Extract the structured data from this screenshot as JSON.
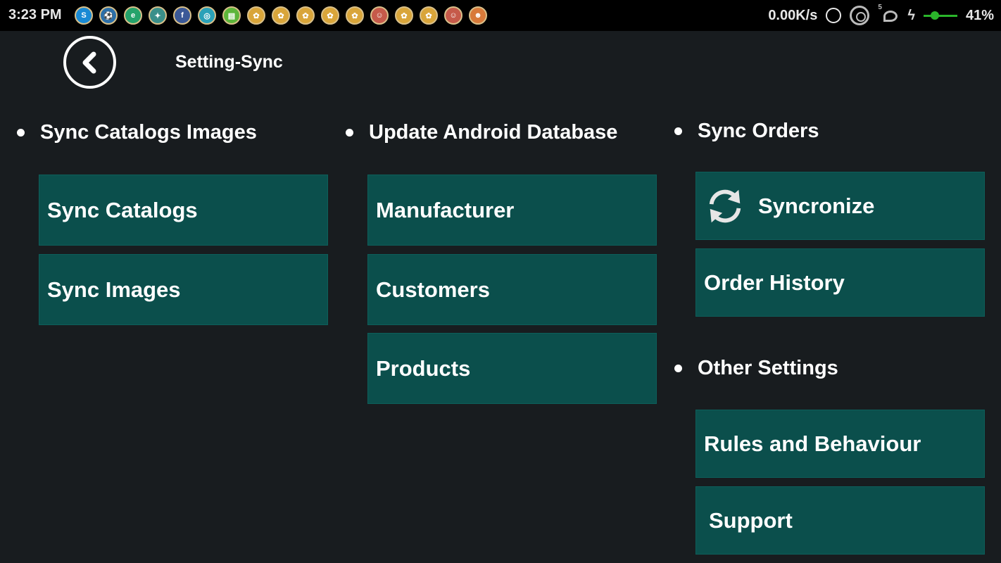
{
  "statusbar": {
    "time": "3:23 PM",
    "net_speed": "0.00K/s",
    "battery_pct": "41%",
    "signal_sup": "5",
    "notifications": [
      {
        "icon": "skype-notification-icon",
        "glyph": "S",
        "color": "#1a8ad4"
      },
      {
        "icon": "soccer-notification-icon",
        "glyph": "⚽",
        "color": "#2c6fa8"
      },
      {
        "icon": "app-notification-icon",
        "glyph": "e",
        "color": "#25a36b"
      },
      {
        "icon": "chat-notification-icon",
        "glyph": "✦",
        "color": "#3a8f8a"
      },
      {
        "icon": "facebook-notification-icon",
        "glyph": "f",
        "color": "#3b5998"
      },
      {
        "icon": "app-notification-icon",
        "glyph": "◎",
        "color": "#2aa1b8"
      },
      {
        "icon": "sms-notification-icon",
        "glyph": "▤",
        "color": "#5db53a"
      },
      {
        "icon": "app-notification-icon",
        "glyph": "✿",
        "color": "#d9a53a"
      },
      {
        "icon": "app-notification-icon",
        "glyph": "✿",
        "color": "#d9a53a"
      },
      {
        "icon": "app-notification-icon",
        "glyph": "✿",
        "color": "#d9a53a"
      },
      {
        "icon": "app-notification-icon",
        "glyph": "✿",
        "color": "#d9a53a"
      },
      {
        "icon": "app-notification-icon",
        "glyph": "✿",
        "color": "#d9a53a"
      },
      {
        "icon": "app-notification-icon",
        "glyph": "☺",
        "color": "#c65a4a"
      },
      {
        "icon": "app-notification-icon",
        "glyph": "✿",
        "color": "#d9a53a"
      },
      {
        "icon": "app-notification-icon",
        "glyph": "✿",
        "color": "#d9a53a"
      },
      {
        "icon": "app-notification-icon",
        "glyph": "☺",
        "color": "#c65a4a"
      },
      {
        "icon": "app-notification-icon",
        "glyph": "☻",
        "color": "#d87a3a"
      }
    ]
  },
  "header": {
    "title": "Setting-Sync",
    "back_icon": "chevron-left-icon"
  },
  "sections": {
    "catalogs": {
      "title": "Sync Catalogs Images",
      "buttons": [
        "Sync Catalogs",
        "Sync Images"
      ]
    },
    "database": {
      "title": "Update Android Database",
      "buttons": [
        "Manufacturer",
        "Customers",
        "Products"
      ]
    },
    "orders": {
      "title": "Sync Orders",
      "sync_button": "Syncronize",
      "sync_icon": "sync-icon",
      "history_button": "Order History"
    },
    "other": {
      "title": "Other Settings",
      "buttons": [
        "Rules and Behaviour",
        "Support"
      ]
    }
  },
  "colors": {
    "background": "#181c1f",
    "tile": "#0b4f4c",
    "statusbar": "#000000",
    "text": "#ffffff"
  }
}
